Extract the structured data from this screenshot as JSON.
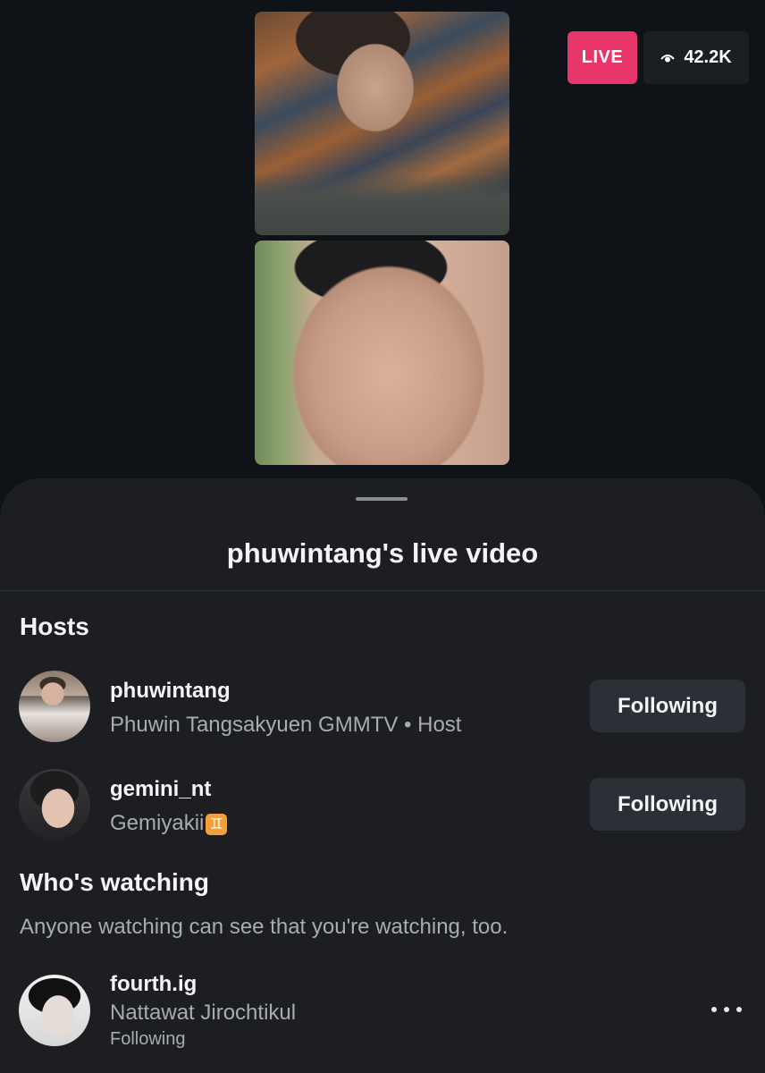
{
  "live": {
    "badge_label": "LIVE",
    "viewer_count": "42.2K",
    "badge_color": "#e8356a"
  },
  "sheet": {
    "title": "phuwintang's live video",
    "hosts_heading": "Hosts",
    "hosts": [
      {
        "username": "phuwintang",
        "subtitle": "Phuwin Tangsakyuen GMMTV • Host",
        "button_label": "Following"
      },
      {
        "username": "gemini_nt",
        "subtitle": "Gemiyakii",
        "emoji": "♊",
        "button_label": "Following"
      }
    ],
    "watching_heading": "Who's watching",
    "watching_note": "Anyone watching can see that you're watching, too.",
    "viewers": [
      {
        "username": "fourth.ig",
        "fullname": "Nattawat Jirochtikul",
        "status": "Following"
      }
    ]
  },
  "icons": {
    "viewer": "eye-icon",
    "more": "more-options-icon",
    "gemini": "gemini-zodiac-icon"
  }
}
